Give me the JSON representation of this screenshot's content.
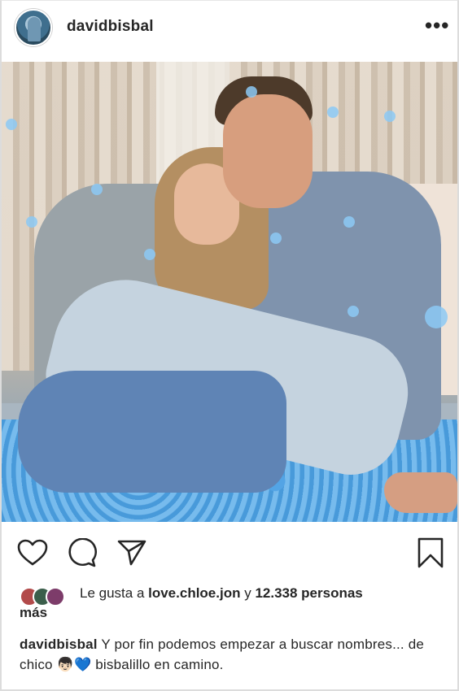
{
  "post": {
    "username": "davidbisbal",
    "more_label": "•••"
  },
  "likes": {
    "prefix": "Le gusta a ",
    "user": "love.chloe.jon",
    "middle": " y ",
    "count": "12.338 personas",
    "suffix": " más"
  },
  "caption": {
    "username": "davidbisbal",
    "text_1": " Y por fin podemos empezar a buscar nombres... de chico ",
    "emoji_1": "👦🏻",
    "emoji_2": "💙",
    "text_2": " bisbalillo en camino."
  },
  "icons": [
    "heart-icon",
    "comment-icon",
    "share-icon",
    "bookmark-icon"
  ],
  "colors": {
    "text": "#262626",
    "confetti": "#5eb2f0"
  }
}
